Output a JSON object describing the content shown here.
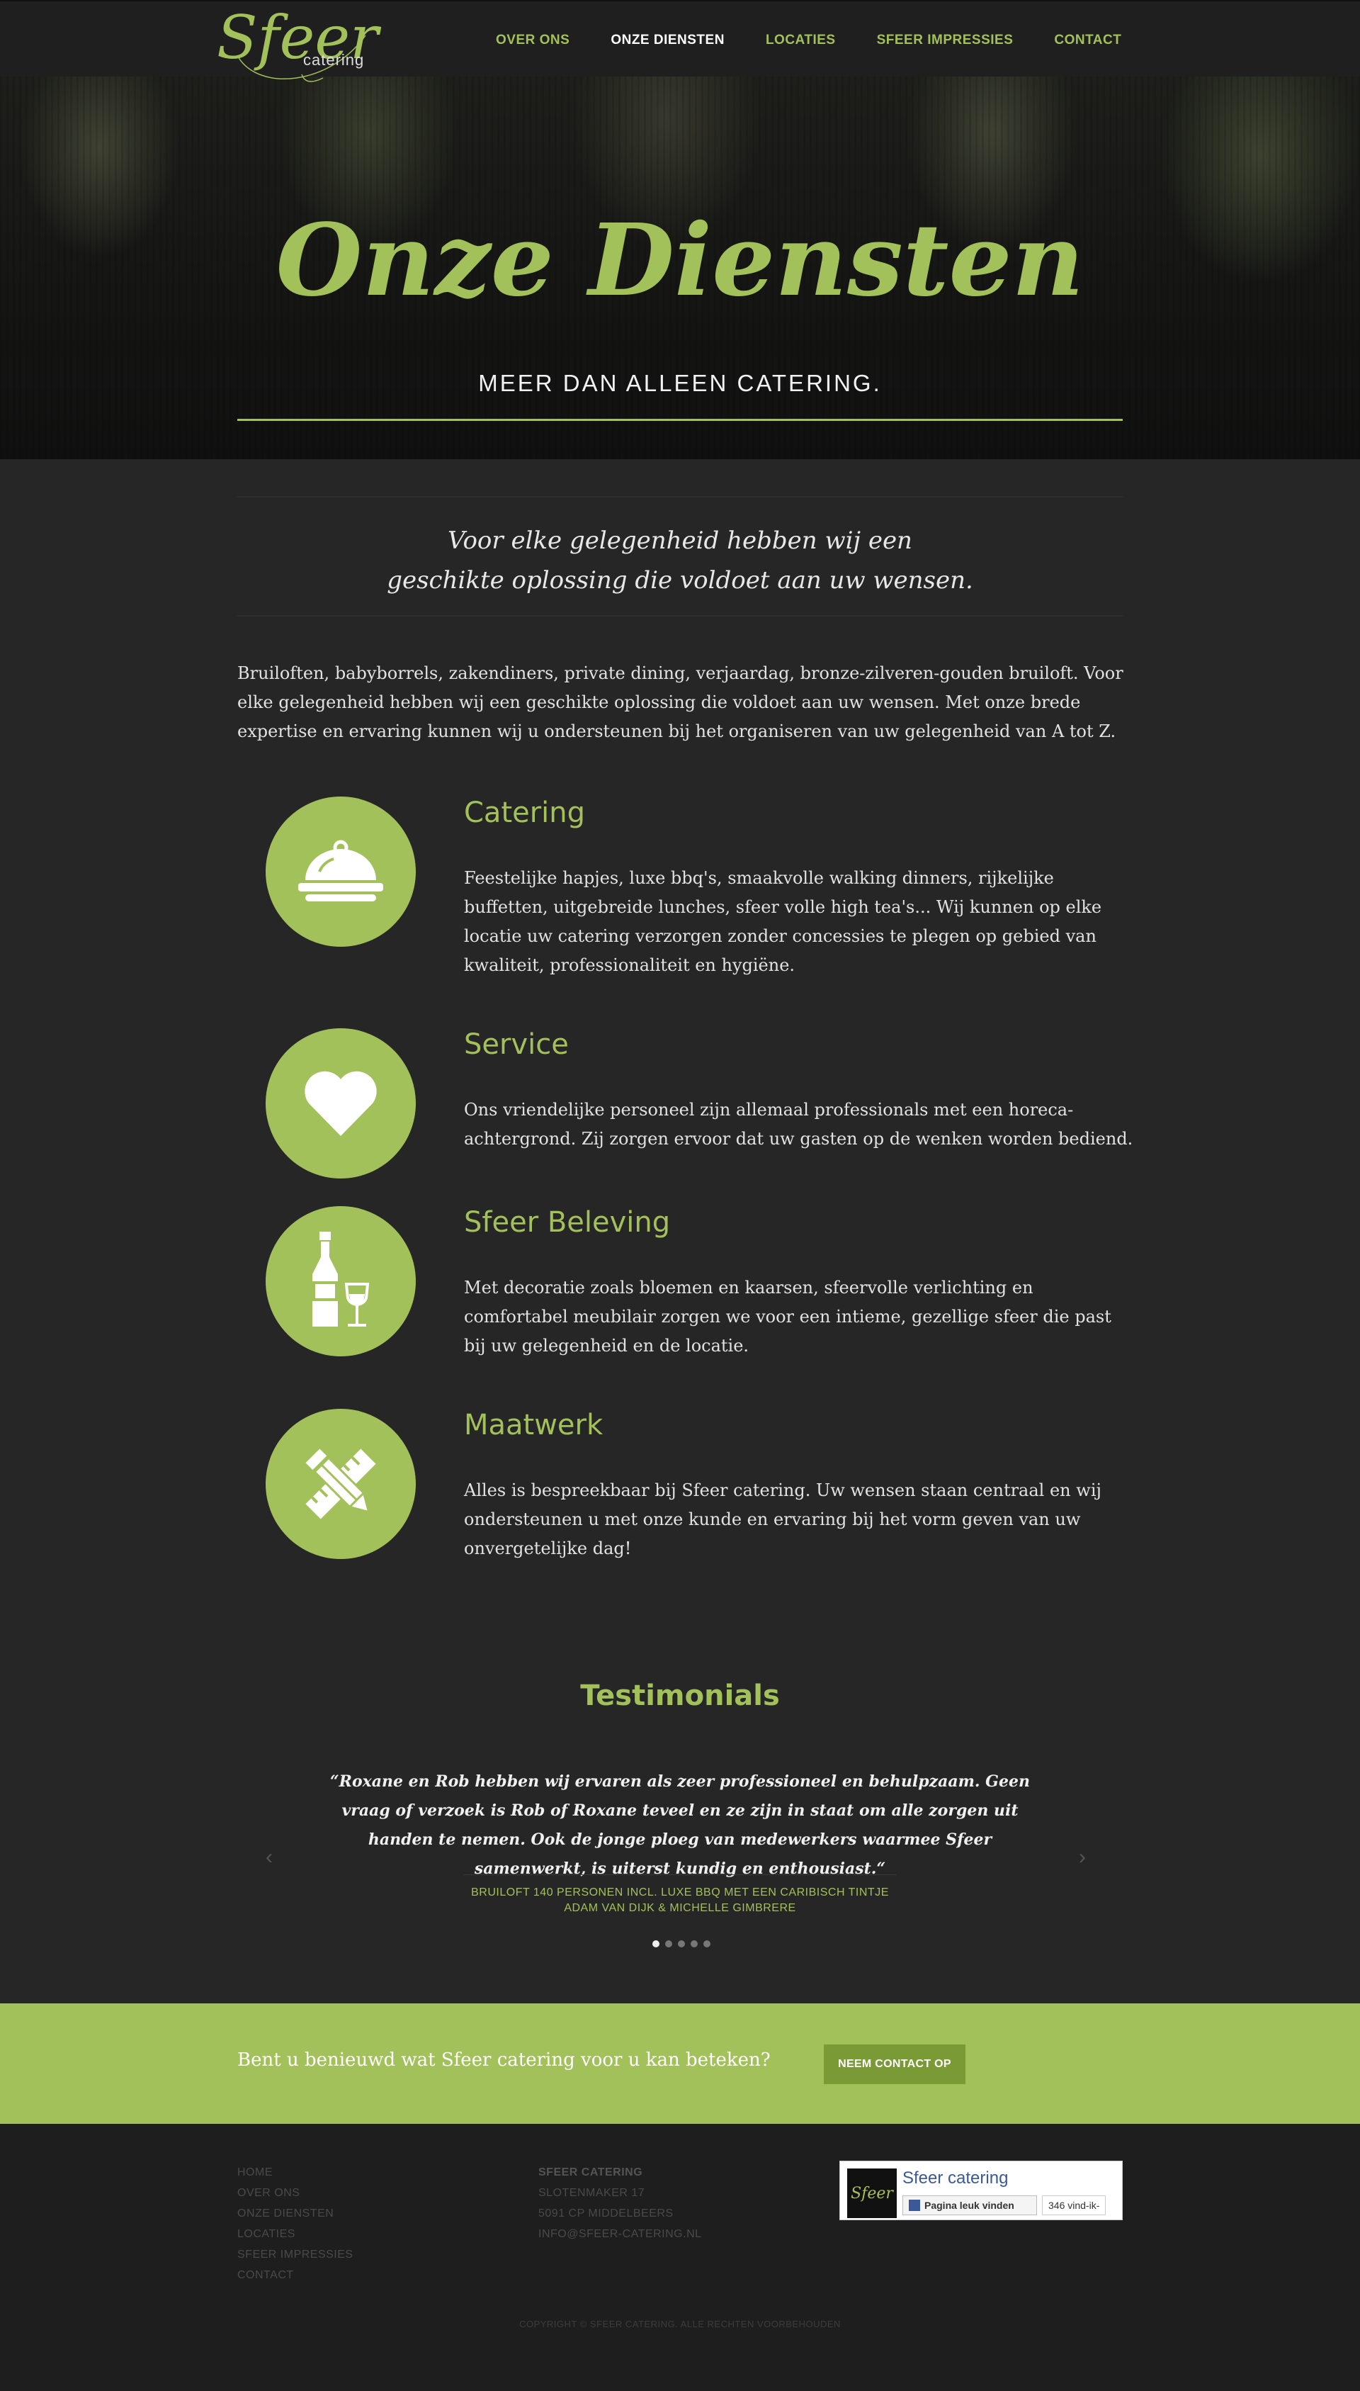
{
  "brand": {
    "script": "Sfeer",
    "small": "catering"
  },
  "nav": {
    "items": [
      {
        "label": "OVER ONS",
        "active": false
      },
      {
        "label": "ONZE DIENSTEN",
        "active": true
      },
      {
        "label": "LOCATIES",
        "active": false
      },
      {
        "label": "SFEER IMPRESSIES",
        "active": false
      },
      {
        "label": "CONTACT",
        "active": false
      }
    ]
  },
  "hero": {
    "title": "Onze Diensten",
    "subtitle": "MEER DAN ALLEEN CATERING."
  },
  "intro": {
    "line1": "Voor elke gelegenheid hebben wij een",
    "line2": "geschikte oplossing die voldoet aan uw wensen."
  },
  "lead": "Bruiloften, babyborrels, zakendiners, private dining, verjaardag, bronze-zilveren-gouden bruiloft. Voor elke gelegenheid hebben wij een geschikte oplossing die voldoet aan uw wensen. Met onze brede expertise en ervaring kunnen wij u ondersteunen bij het organiseren van uw gelegenheid van A tot Z.",
  "services": [
    {
      "icon": "cloche-icon",
      "title": "Catering",
      "text": "Feestelijke hapjes, luxe bbq's, smaakvolle walking dinners, rijkelijke buffetten, uitgebreide lunches, sfeer volle high tea's... Wij kunnen op elke locatie uw catering verzorgen zonder concessies te plegen op gebied van kwaliteit, professionaliteit en hygiëne."
    },
    {
      "icon": "heart-icon",
      "title": "Service",
      "text": "Ons vriendelijke personeel zijn allemaal professionals met een horeca-achtergrond. Zij zorgen ervoor dat uw gasten op de wenken worden bediend."
    },
    {
      "icon": "bottle-glass-icon",
      "title": "Sfeer Beleving",
      "text": "Met decoratie zoals bloemen en kaarsen, sfeervolle verlichting en comfortabel meubilair zorgen we voor een intieme, gezellige sfeer die past bij uw gelegenheid en de locatie."
    },
    {
      "icon": "pencil-ruler-icon",
      "title": "Maatwerk",
      "text": "Alles is bespreekbaar bij Sfeer catering. Uw wensen staan centraal en wij ondersteunen u met onze kunde en ervaring bij het vorm geven van uw onvergetelijke dag!"
    }
  ],
  "testimonials": {
    "title": "Testimonials",
    "quote": "“Roxane en Rob hebben wij ervaren als zeer professioneel en behulpzaam. Geen vraag of verzoek is Rob of Roxane teveel en ze zijn in staat om alle zorgen uit handen te nemen. Ook de jonge ploeg van medewerkers waarmee Sfeer samenwerkt, is uiterst kundig en enthousiast.“",
    "source_line1": "BRUILOFT 140 PERSONEN INCL. LUXE BBQ MET EEN CARIBISCH TINTJE",
    "source_line2": "ADAM VAN DIJK & MICHELLE GIMBRERE",
    "prev": "‹",
    "next": "›",
    "slide_count": 5,
    "active_slide": 0
  },
  "cta": {
    "text": "Bent u benieuwd wat Sfeer catering voor u kan beteken?",
    "button": "NEEM CONTACT OP"
  },
  "footer": {
    "links": [
      "HOME",
      "OVER ONS",
      "ONZE DIENSTEN",
      "LOCATIES",
      "SFEER IMPRESSIES",
      "CONTACT"
    ],
    "address": {
      "name": "SFEER CATERING",
      "street": "SLOTENMAKER 17",
      "city": "5091 CP MIDDELBEERS",
      "email": "INFO@SFEER-CATERING.NL"
    },
    "facebook": {
      "name": "Sfeer catering",
      "like": "Pagina leuk vinden",
      "count": "346 vind-ik-"
    },
    "copyright": "COPYRIGHT © SFEER CATERING. ALLE RECHTEN VOORBEHOUDEN"
  },
  "colors": {
    "accent": "#a3c15a",
    "accent_dark": "#7a9a36",
    "bg": "#262626",
    "footer_bg": "#1e1e1e"
  }
}
